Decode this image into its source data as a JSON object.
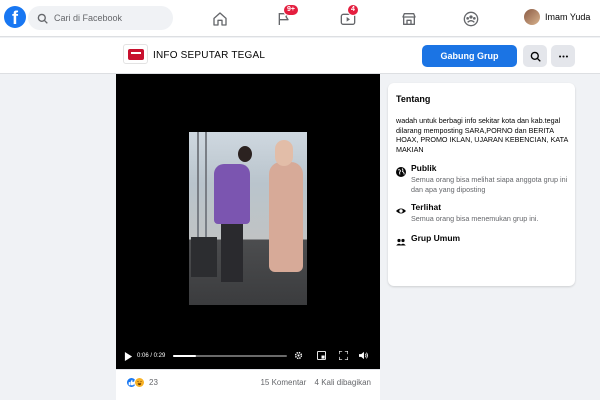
{
  "topnav": {
    "logo_letter": "f",
    "search_placeholder": "Cari di Facebook",
    "nav": [
      {
        "icon": "home-icon",
        "badge": ""
      },
      {
        "icon": "flag-icon",
        "badge": "9+"
      },
      {
        "icon": "watch-icon",
        "badge": "4"
      },
      {
        "icon": "marketplace-icon",
        "badge": ""
      },
      {
        "icon": "groups-icon",
        "badge": ""
      }
    ],
    "user_name": "Imam Yuda"
  },
  "group": {
    "name": "INFO SEPUTAR TEGAL",
    "join_label": "Gabung Grup",
    "accent": "#1b74e4"
  },
  "video": {
    "time": "0:06 / 0:29",
    "progress": 0.2
  },
  "post": {
    "reaction_count": "23",
    "comments": "15 Komentar",
    "shares": "4 Kali dibagikan"
  },
  "about": {
    "title": "Tentang",
    "desc_line1": "wadah untuk berbagi info sekitar kota dan kab.tegal",
    "desc_line2": "dilarang memposting SARA,PORNO dan BERITA HOAX, PROMO IKLAN, UJARAN KEBENCIAN, KATA MAKIAN",
    "public_title": "Publik",
    "public_desc": "Semua orang bisa melihat siapa anggota grup ini dan apa yang diposting",
    "visible_title": "Terlihat",
    "visible_desc": "Semua orang bisa menemukan grup ini.",
    "general_title": "Grup Umum"
  }
}
